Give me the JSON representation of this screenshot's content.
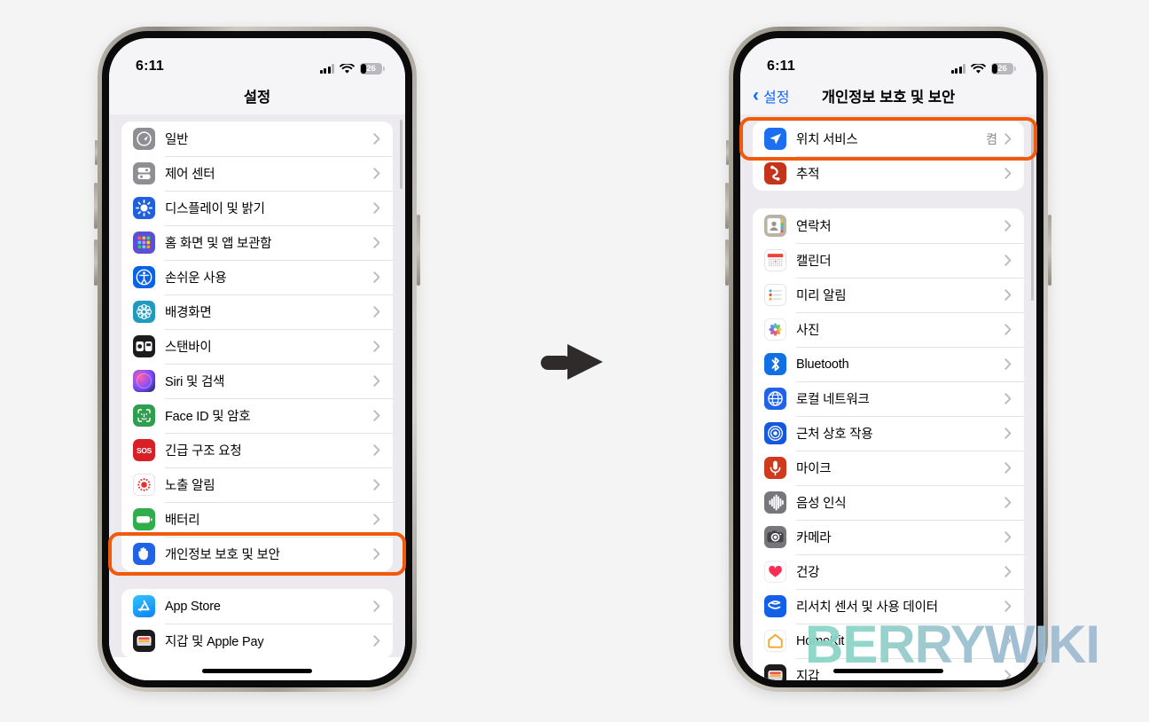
{
  "meta": {
    "background_color": "#f4f4f4",
    "highlight_color": "#f05a0a",
    "watermark": "BERRYWIKI"
  },
  "arrow": {
    "name": "right-arrow"
  },
  "phone_left": {
    "status": {
      "time": "6:11",
      "battery_percent": "26"
    },
    "nav": {
      "title": "설정"
    },
    "groups": [
      {
        "rows": [
          {
            "label": "일반",
            "icon": "gear-icon",
            "icon_class": "ic-general",
            "glyph": "general"
          },
          {
            "label": "제어 센터",
            "icon": "control-center-icon",
            "icon_class": "ic-control",
            "glyph": "control"
          },
          {
            "label": "디스플레이 및 밝기",
            "icon": "brightness-icon",
            "icon_class": "ic-display",
            "glyph": "sun"
          },
          {
            "label": "홈 화면 및 앱 보관함",
            "icon": "home-screen-icon",
            "icon_class": "ic-home",
            "glyph": "grid"
          },
          {
            "label": "손쉬운 사용",
            "icon": "accessibility-icon",
            "icon_class": "ic-access",
            "glyph": "person"
          },
          {
            "label": "배경화면",
            "icon": "wallpaper-icon",
            "icon_class": "ic-wall",
            "glyph": "flower"
          },
          {
            "label": "스탠바이",
            "icon": "standby-icon",
            "icon_class": "ic-standby",
            "glyph": "standby"
          },
          {
            "label": "Siri 및 검색",
            "icon": "siri-icon",
            "icon_class": "ic-siri",
            "glyph": "orb"
          },
          {
            "label": "Face ID 및 암호",
            "icon": "face-id-icon",
            "icon_class": "ic-faceid",
            "glyph": "faceid"
          },
          {
            "label": "긴급 구조 요청",
            "icon": "sos-icon",
            "icon_class": "ic-sos",
            "glyph": "sos"
          },
          {
            "label": "노출 알림",
            "icon": "exposure-notification-icon",
            "icon_class": "ic-expose",
            "glyph": "burst"
          },
          {
            "label": "배터리",
            "icon": "battery-icon",
            "icon_class": "ic-battery",
            "glyph": "batt"
          },
          {
            "label": "개인정보 보호 및 보안",
            "icon": "privacy-hand-icon",
            "icon_class": "ic-privacy",
            "glyph": "hand",
            "highlighted": true
          }
        ]
      },
      {
        "rows": [
          {
            "label": "App Store",
            "icon": "app-store-icon",
            "icon_class": "ic-appstore",
            "glyph": "appstore"
          },
          {
            "label": "지갑 및 Apple Pay",
            "icon": "wallet-icon",
            "icon_class": "ic-wallet",
            "glyph": "wallet"
          }
        ]
      }
    ]
  },
  "phone_right": {
    "status": {
      "time": "6:11",
      "battery_percent": "26"
    },
    "nav": {
      "back_label": "설정",
      "title": "개인정보 보호 및 보안"
    },
    "groups": [
      {
        "rows": [
          {
            "label": "위치 서비스",
            "value": "켬",
            "icon": "location-services-icon",
            "icon_class": "ic-location",
            "glyph": "arrowloc",
            "highlighted": true
          },
          {
            "label": "추적",
            "icon": "tracking-icon",
            "icon_class": "ic-track",
            "glyph": "track"
          }
        ]
      },
      {
        "rows": [
          {
            "label": "연락처",
            "icon": "contacts-icon",
            "icon_class": "ic-contacts",
            "glyph": "contacts"
          },
          {
            "label": "캘린더",
            "icon": "calendar-icon",
            "icon_class": "ic-calendar",
            "glyph": "calendar"
          },
          {
            "label": "미리 알림",
            "icon": "reminders-icon",
            "icon_class": "ic-reminder",
            "glyph": "reminder"
          },
          {
            "label": "사진",
            "icon": "photos-icon",
            "icon_class": "ic-photos",
            "glyph": "photos"
          },
          {
            "label": "Bluetooth",
            "icon": "bluetooth-icon",
            "icon_class": "ic-bt",
            "glyph": "bt"
          },
          {
            "label": "로컬 네트워크",
            "icon": "local-network-icon",
            "icon_class": "ic-localnet",
            "glyph": "globe"
          },
          {
            "label": "근처 상호 작용",
            "icon": "nearby-interactions-icon",
            "icon_class": "ic-nearby",
            "glyph": "nearby"
          },
          {
            "label": "마이크",
            "icon": "microphone-icon",
            "icon_class": "ic-mic",
            "glyph": "mic"
          },
          {
            "label": "음성 인식",
            "icon": "speech-recognition-icon",
            "icon_class": "ic-speech",
            "glyph": "wave"
          },
          {
            "label": "카메라",
            "icon": "camera-icon",
            "icon_class": "ic-camera",
            "glyph": "camera"
          },
          {
            "label": "건강",
            "icon": "health-icon",
            "icon_class": "ic-health",
            "glyph": "heart"
          },
          {
            "label": "리서치 센서 및 사용 데이터",
            "icon": "research-sensor-icon",
            "icon_class": "ic-research",
            "glyph": "research"
          },
          {
            "label": "HomeKit",
            "icon": "homekit-icon",
            "icon_class": "ic-homekit",
            "glyph": "homekit"
          },
          {
            "label": "지갑",
            "icon": "wallet-icon",
            "icon_class": "ic-wallet2",
            "glyph": "wallet"
          }
        ]
      }
    ]
  }
}
